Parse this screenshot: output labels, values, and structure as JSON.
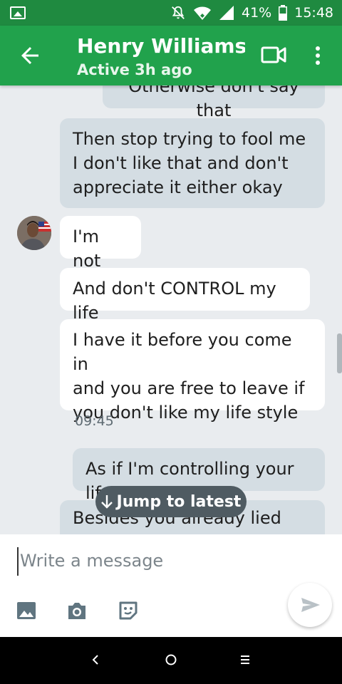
{
  "status_bar": {
    "battery_percent": "41%",
    "time": "15:48",
    "icons": [
      "image-icon",
      "mute-icon",
      "wifi-icon",
      "signal-icon",
      "battery-icon"
    ]
  },
  "header": {
    "contact_name": "Henry Williams…",
    "presence": "Active 3h ago",
    "icons": [
      "back-arrow-icon",
      "video-call-icon",
      "more-vert-icon"
    ]
  },
  "messages": [
    {
      "sender": "me",
      "lines": [
        "Otherwise don't say that"
      ]
    },
    {
      "sender": "me",
      "lines": [
        "Then stop trying to fool me",
        "I don't like that and don't",
        "appreciate it either okay"
      ]
    },
    {
      "sender": "them",
      "lines": [
        "I'm not"
      ]
    },
    {
      "sender": "them",
      "lines": [
        "And don't CONTROL my life"
      ]
    },
    {
      "sender": "them",
      "lines": [
        "I have it before you come in",
        "and you are free to leave if",
        "you don't like my life style"
      ]
    },
    {
      "sender": "me",
      "lines": [
        "As if I'm controlling your life"
      ]
    },
    {
      "sender": "me",
      "lines": [
        "Besides you already lied"
      ]
    }
  ],
  "timestamp": "09:45",
  "jump_button": {
    "label": "Jump to latest",
    "icon": "arrow-down-icon"
  },
  "composer": {
    "placeholder": "Write a message",
    "tools": [
      "gallery-icon",
      "camera-icon",
      "sticker-icon"
    ],
    "send_icon": "send-icon"
  },
  "navigation_bar": [
    "nav-back-icon",
    "nav-home-icon",
    "nav-recents-icon"
  ],
  "colors": {
    "status_bar": "#1f8a40",
    "app_bar": "#21a24c",
    "my_bubble": "#d4dde3",
    "their_bubble": "#ffffff",
    "jump_button": "#4f5b62"
  }
}
